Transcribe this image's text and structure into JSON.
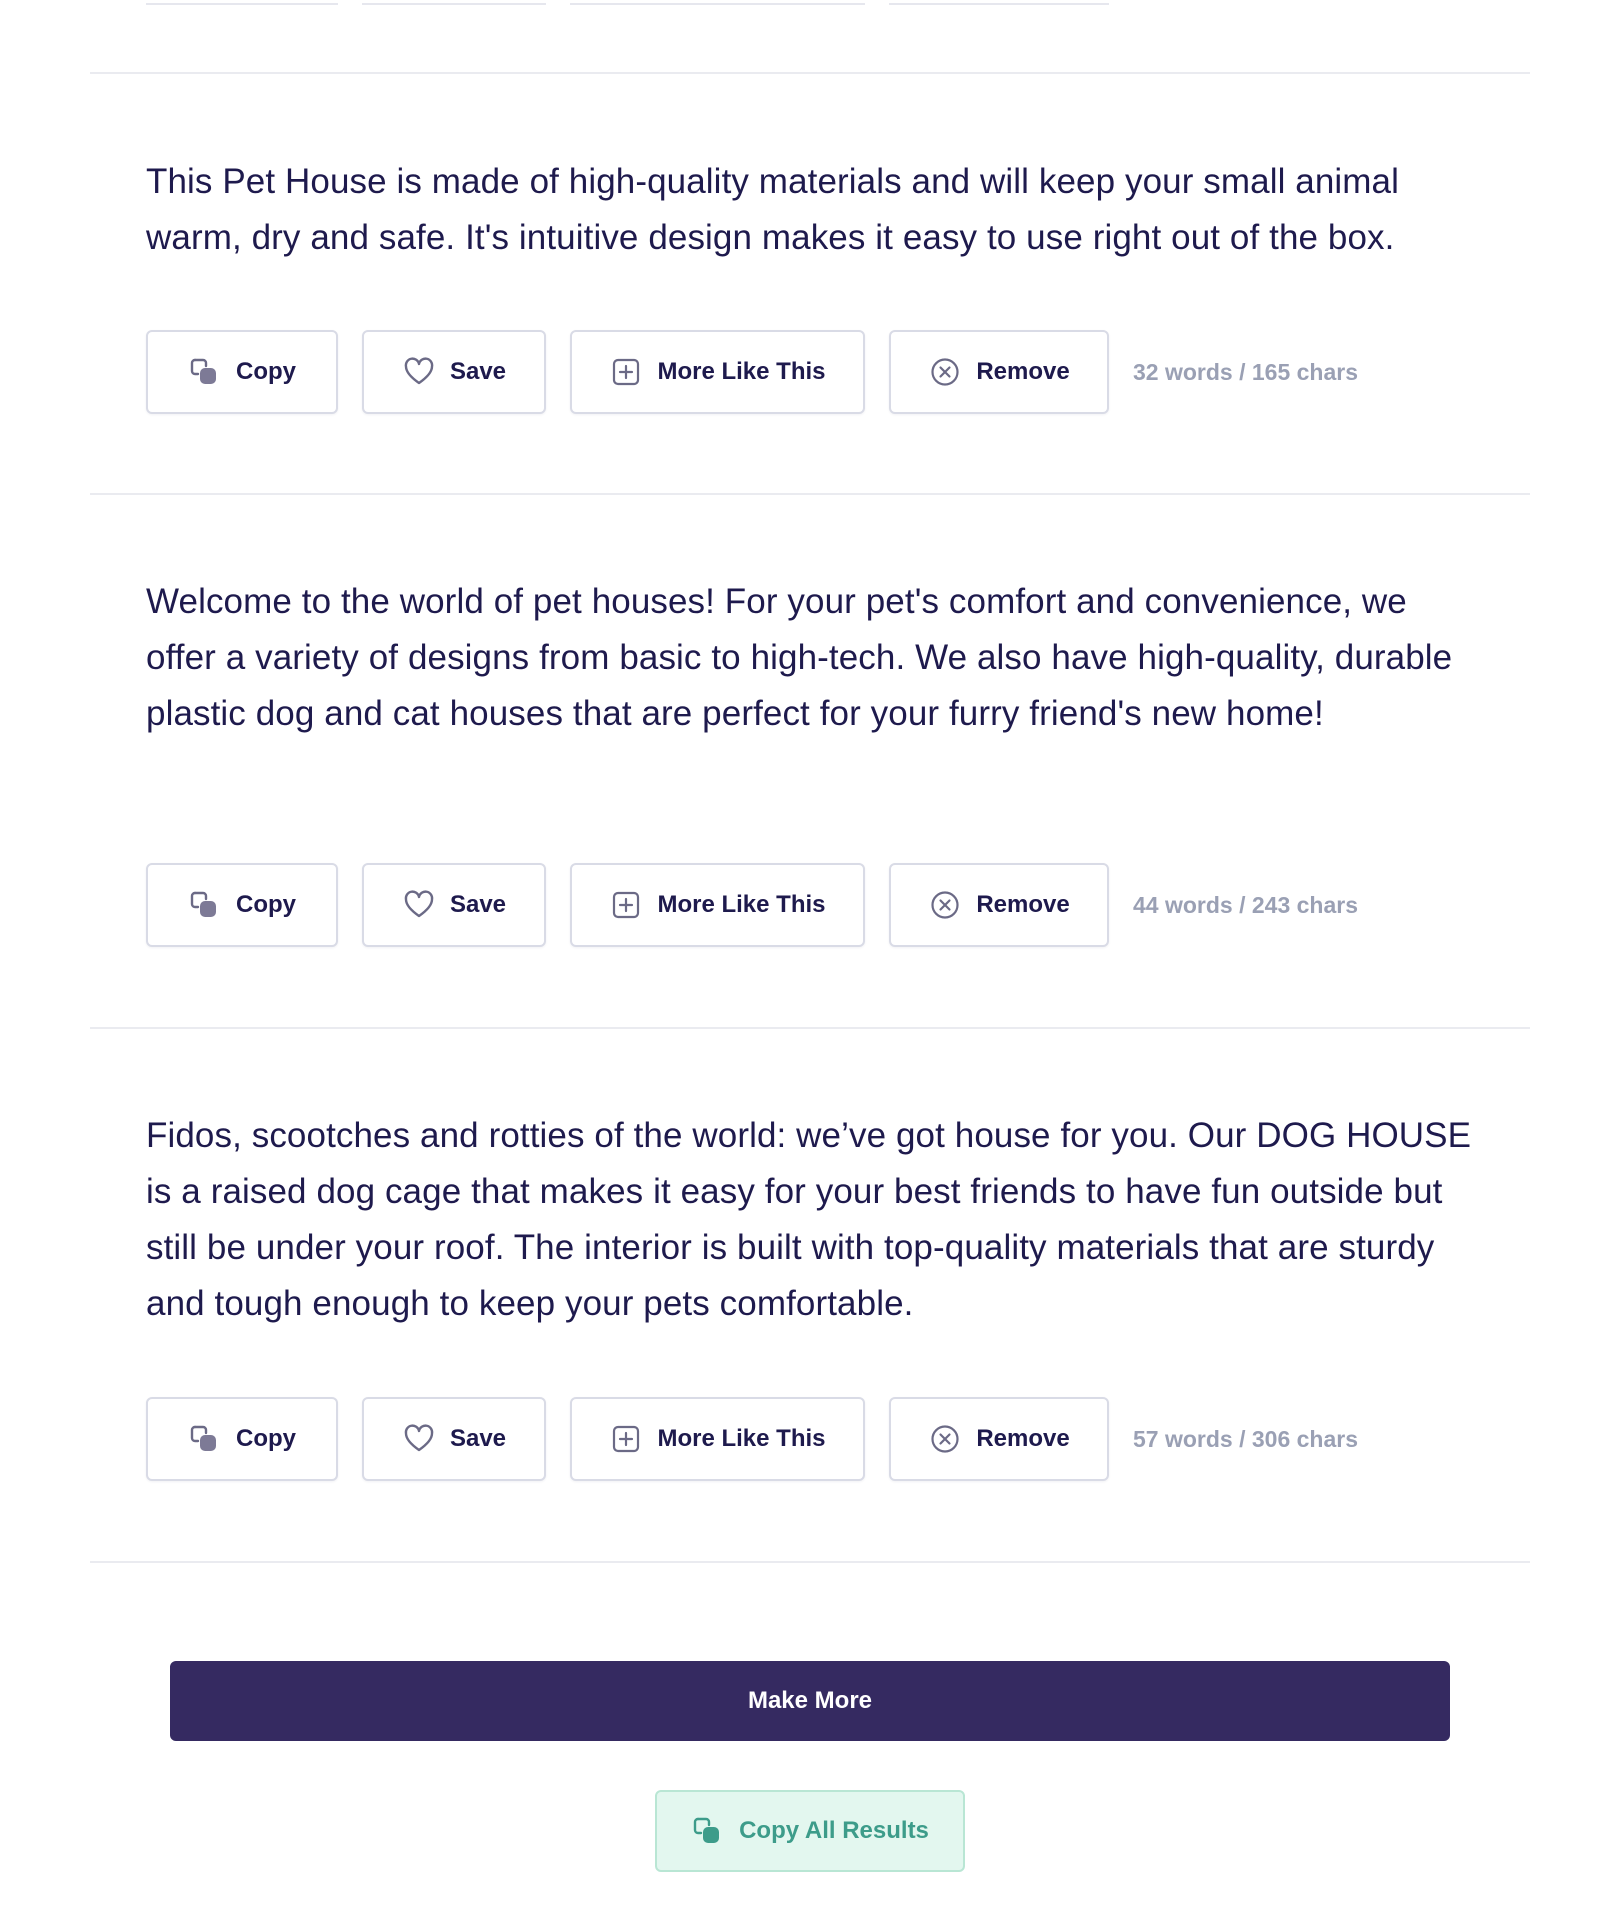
{
  "results": [
    {
      "text": "This Pet House is made of high-quality materials and will keep your small animal warm, dry and safe. It's intuitive design makes it easy to use right out of the box.",
      "counts": "32 words / 165 chars"
    },
    {
      "text": "Welcome to the world of pet houses! For your pet's comfort and convenience, we offer a variety of designs from basic to high-tech. We also have high-quality, durable plastic dog and cat houses that are perfect for your furry friend's new home!",
      "counts": "44 words / 243 chars"
    },
    {
      "text": "Fidos, scootches and rotties of the world: we’ve got house for you. Our DOG HOUSE is a raised dog cage that makes it easy for your best friends to have fun outside but still be under your roof. The interior is built with top-quality materials that are sturdy and tough enough to keep your pets comfortable.",
      "counts": "57 words / 306 chars"
    }
  ],
  "actions": {
    "copy_label": "Copy",
    "save_label": "Save",
    "more_like_this_label": "More Like This",
    "remove_label": "Remove"
  },
  "footer": {
    "make_more_label": "Make More",
    "copy_all_label": "Copy All Results"
  },
  "colors": {
    "text": "#1e1a4d",
    "primary_button": "#352a61",
    "copy_all_bg": "#e3f7ef",
    "copy_all_text": "#3d9c8a",
    "counts_text": "#9aa0b4"
  }
}
